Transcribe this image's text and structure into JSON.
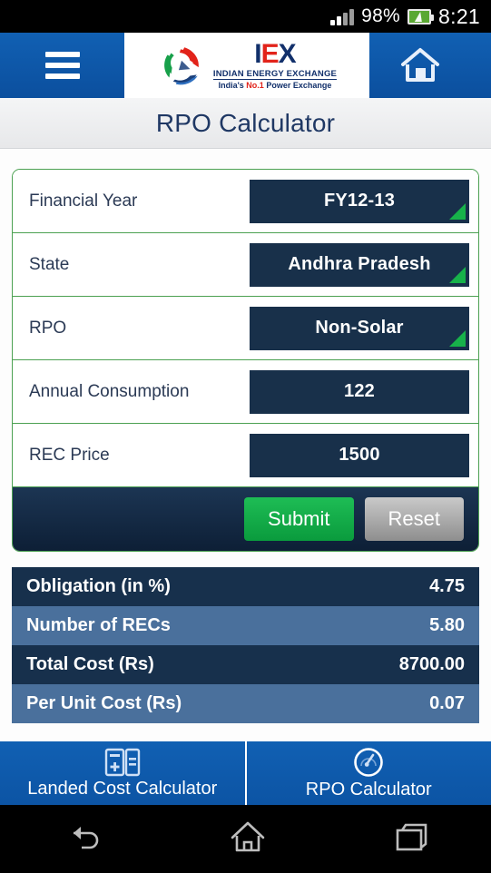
{
  "status_bar": {
    "battery_percent": "98%",
    "time": "8:21",
    "signal_icon": "signal-bars-icon",
    "battery_icon": "battery-charging-icon"
  },
  "app_bar": {
    "menu_icon": "hamburger-menu-icon",
    "home_icon": "home-icon",
    "logo": {
      "mark": "iex-swirl-logo-icon",
      "name_part1": "I",
      "name_part2": "E",
      "name_part3": "X",
      "tagline_1": "INDIAN ENERGY EXCHANGE",
      "tagline_2_pre": "India's ",
      "tagline_2_mid": "No.1",
      "tagline_2_post": " Power Exchange"
    }
  },
  "page": {
    "title": "RPO Calculator"
  },
  "form": {
    "rows": [
      {
        "label": "Financial Year",
        "value": "FY12-13",
        "type": "dropdown"
      },
      {
        "label": "State",
        "value": "Andhra Pradesh",
        "type": "dropdown"
      },
      {
        "label": "RPO",
        "value": "Non-Solar",
        "type": "dropdown"
      },
      {
        "label": "Annual Consumption",
        "value": "122",
        "type": "input"
      },
      {
        "label": "REC Price",
        "value": "1500",
        "type": "input"
      }
    ],
    "submit_label": "Submit",
    "reset_label": "Reset"
  },
  "results": {
    "rows": [
      {
        "label": "Obligation (in %)",
        "value": "4.75"
      },
      {
        "label": "Number of RECs",
        "value": "5.80"
      },
      {
        "label": "Total Cost (Rs)",
        "value": "8700.00"
      },
      {
        "label": "Per Unit Cost (Rs)",
        "value": "0.07"
      }
    ]
  },
  "bottom_tabs": [
    {
      "label": "Landed Cost Calculator",
      "icon": "calculator-icon"
    },
    {
      "label": "RPO Calculator",
      "icon": "gauge-icon"
    }
  ],
  "android_nav": {
    "back_icon": "back-arrow-icon",
    "home_icon": "home-outline-icon",
    "recents_icon": "recent-apps-icon"
  },
  "colors": {
    "header_blue": "#1160b3",
    "field_navy": "#18304a",
    "border_green": "#4ca152",
    "spinner_green": "#17b24a",
    "submit_green": "#1ebd55",
    "reset_gray": "#9a9a9a",
    "result_dark": "#17304c",
    "result_light": "#4a709c",
    "title_navy": "#1f3864",
    "logo_red": "#e2231a"
  }
}
